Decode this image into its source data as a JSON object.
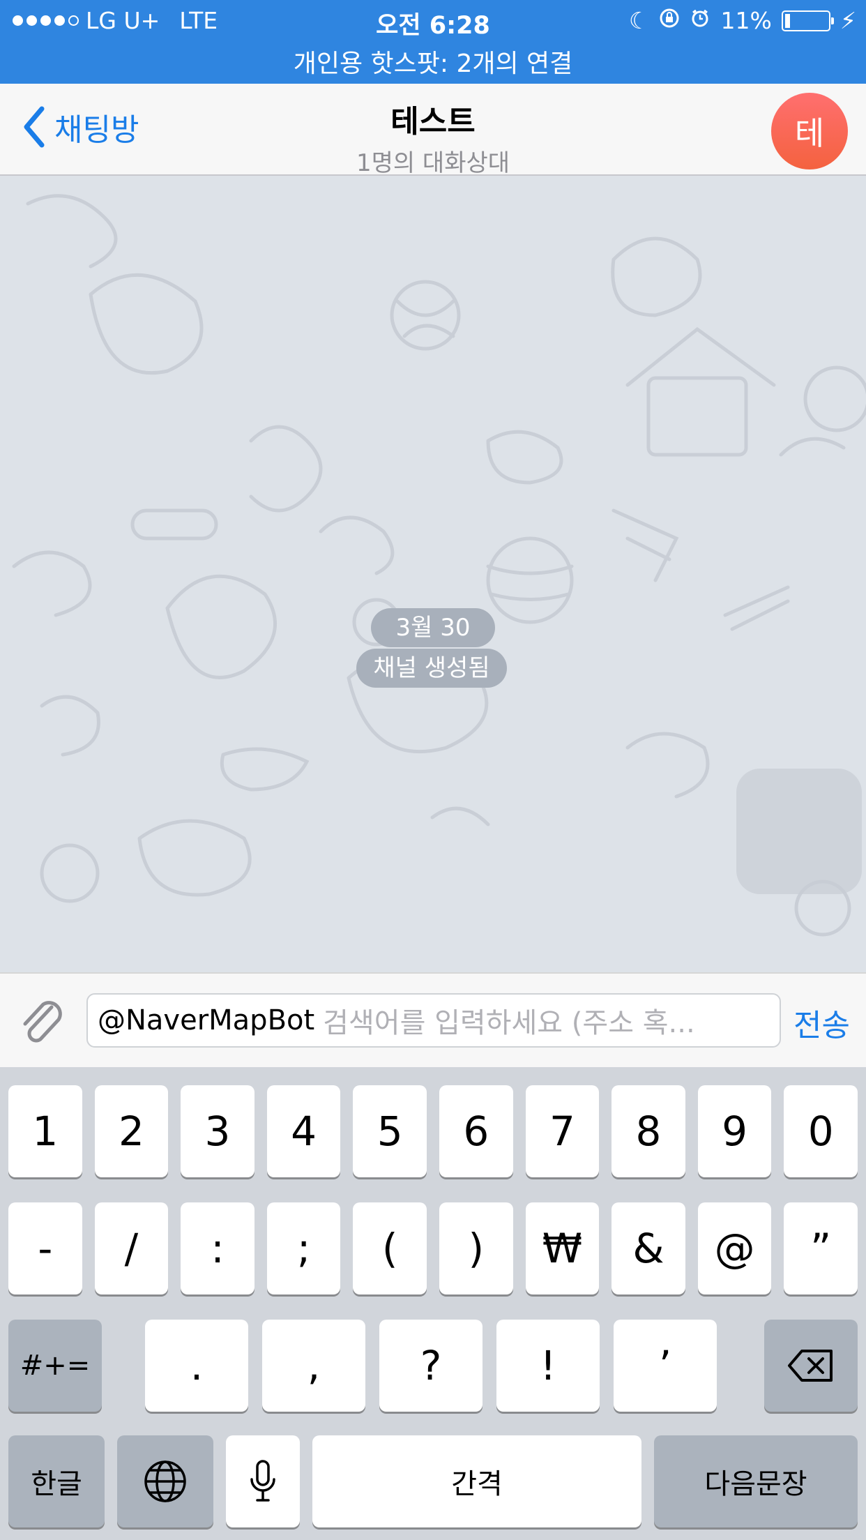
{
  "status_bar": {
    "carrier": "LG U+",
    "network": "LTE",
    "time": "오전 6:28",
    "battery": "11%",
    "battery_level": 0.11,
    "hotspot": "개인용 핫스팟: 2개의 연결"
  },
  "nav": {
    "back_label": "채팅방",
    "title": "테스트",
    "subtitle": "1명의 대화상대",
    "avatar_letter": "테"
  },
  "chat": {
    "date_label": "3월 30",
    "event_label": "채널 생성됨"
  },
  "input": {
    "mention": "@NaverMapBot",
    "placeholder": "검색어를 입력하세요 (주소 혹...",
    "send_label": "전송"
  },
  "keyboard": {
    "row1": [
      "1",
      "2",
      "3",
      "4",
      "5",
      "6",
      "7",
      "8",
      "9",
      "0"
    ],
    "row2": [
      "-",
      "/",
      ":",
      ";",
      "(",
      ")",
      "₩",
      "&",
      "@",
      "”"
    ],
    "row3": [
      ".",
      ",",
      "?",
      "!",
      "’"
    ],
    "symbols_label": "#+=",
    "lang_label": "한글",
    "space_label": "간격",
    "return_label": "다음문장"
  },
  "colors": {
    "status_bar": "#2f85e0",
    "accent": "#1a7de8",
    "avatar": "#f4623f"
  }
}
